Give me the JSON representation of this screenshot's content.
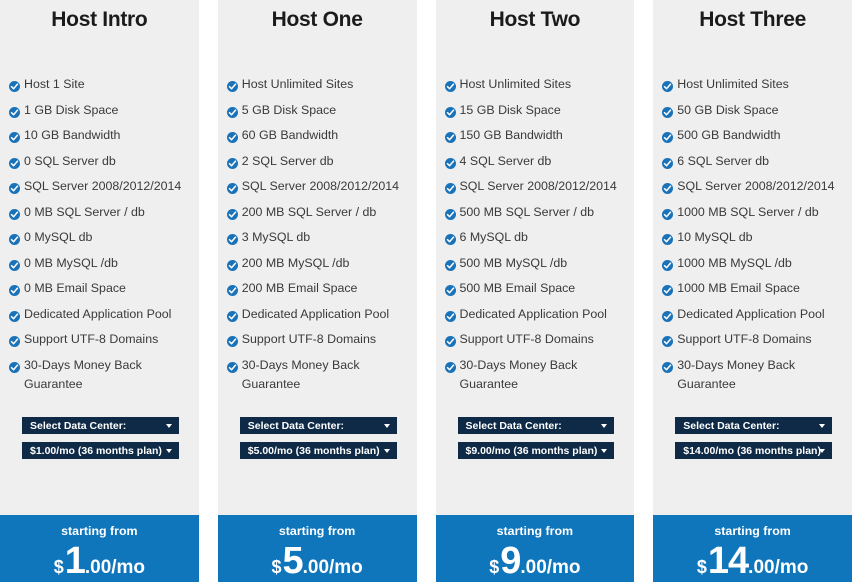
{
  "colors": {
    "card_bg": "#efefef",
    "footer_blue": "#0f76bc",
    "select_navy": "#0e2a47",
    "check_blue": "#1a72b8",
    "title_text": "#1b1b1b",
    "feature_text": "#3a3a3a"
  },
  "common": {
    "starting_from_label": "starting from",
    "currency_symbol": "$",
    "check_icon": "check-circle-icon",
    "caret_icon": "caret-down-icon",
    "data_center_placeholder": "Select Data Center:"
  },
  "plans": [
    {
      "title": "Host Intro",
      "features": [
        "Host 1 Site",
        "1 GB Disk Space",
        "10 GB Bandwidth",
        "0 SQL Server db",
        "SQL Server 2008/2012/2014",
        "0 MB SQL Server / db",
        "0 MySQL db",
        "0 MB MySQL /db",
        "0 MB Email Space",
        "Dedicated Application Pool",
        "Support UTF-8 Domains",
        "30-Days Money Back Guarantee"
      ],
      "data_center_select": "Select Data Center:",
      "plan_select": "$1.00/mo (36 months plan)",
      "price_major": "1",
      "price_minor": ".00/mo"
    },
    {
      "title": "Host One",
      "features": [
        "Host Unlimited Sites",
        "5 GB Disk Space",
        "60 GB Bandwidth",
        "2 SQL Server db",
        "SQL Server 2008/2012/2014",
        "200 MB SQL Server / db",
        "3 MySQL db",
        "200 MB MySQL /db",
        "200 MB Email Space",
        "Dedicated Application Pool",
        "Support UTF-8 Domains",
        "30-Days Money Back Guarantee"
      ],
      "data_center_select": "Select Data Center:",
      "plan_select": "$5.00/mo (36 months plan)",
      "price_major": "5",
      "price_minor": ".00/mo"
    },
    {
      "title": "Host Two",
      "features": [
        "Host Unlimited Sites",
        "15 GB Disk Space",
        "150 GB Bandwidth",
        "4 SQL Server db",
        "SQL Server 2008/2012/2014",
        "500 MB SQL Server / db",
        "6 MySQL db",
        "500 MB MySQL /db",
        "500 MB Email Space",
        "Dedicated Application Pool",
        "Support UTF-8 Domains",
        "30-Days Money Back Guarantee"
      ],
      "data_center_select": "Select Data Center:",
      "plan_select": "$9.00/mo (36 months plan)",
      "price_major": "9",
      "price_minor": ".00/mo"
    },
    {
      "title": "Host Three",
      "features": [
        "Host Unlimited Sites",
        "50 GB Disk Space",
        "500 GB Bandwidth",
        "6 SQL Server db",
        "SQL Server 2008/2012/2014",
        "1000 MB SQL Server / db",
        "10 MySQL db",
        "1000 MB MySQL /db",
        "1000 MB Email Space",
        "Dedicated Application Pool",
        "Support UTF-8 Domains",
        "30-Days Money Back Guarantee"
      ],
      "data_center_select": "Select Data Center:",
      "plan_select": "$14.00/mo (36 months plan)",
      "price_major": "14",
      "price_minor": ".00/mo"
    }
  ]
}
